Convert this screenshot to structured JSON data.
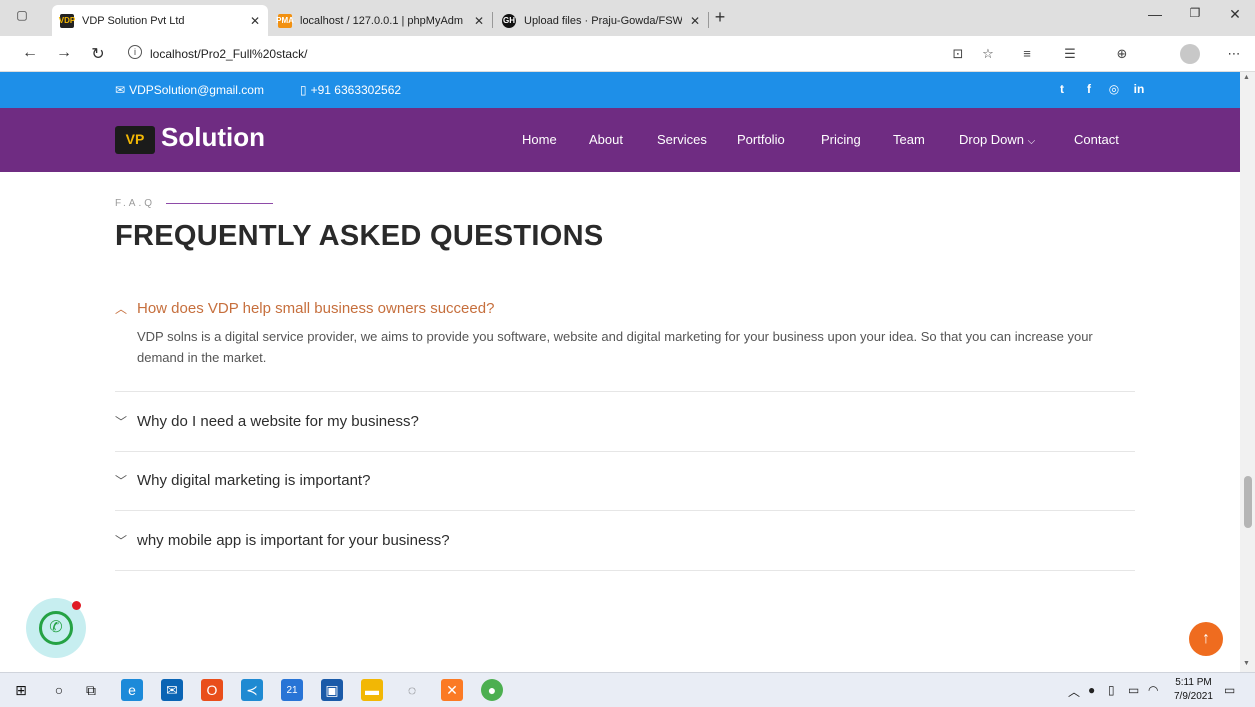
{
  "browser": {
    "tabs": [
      {
        "title": "VDP Solution Pvt Ltd",
        "favicon": "VDP",
        "active": true
      },
      {
        "title": "localhost / 127.0.0.1 | phpMyAdm",
        "favicon": "PMA",
        "active": false
      },
      {
        "title": "Upload files · Praju-Gowda/FSW_",
        "favicon": "GH",
        "active": false
      }
    ],
    "url": "localhost/Pro2_Full%20stack/"
  },
  "topbar": {
    "email": "VDPSolution@gmail.com",
    "phone": "+91 6363302562",
    "social": [
      "twitter-icon",
      "facebook-icon",
      "instagram-icon",
      "linkedin-icon"
    ]
  },
  "header": {
    "logo_mark": "VP",
    "logo_text": "Solution",
    "menu": [
      "Home",
      "About",
      "Services",
      "Portfolio",
      "Pricing",
      "Team",
      "Drop Down",
      "Contact"
    ]
  },
  "faq": {
    "eyebrow": "F.A.Q",
    "title": "FREQUENTLY ASKED QUESTIONS",
    "items": [
      {
        "question": "How does VDP help small business owners succeed?",
        "answer": "VDP solns is a digital service provider, we aims to provide you software, website and digital marketing for your business upon your idea. So that you can increase your demand in the market.",
        "open": true
      },
      {
        "question": "Why do I need a website for my business?",
        "open": false
      },
      {
        "question": "Why digital marketing is important?",
        "open": false
      },
      {
        "question": "why mobile app is important for your business?",
        "open": false
      }
    ]
  },
  "taskbar": {
    "clock_time": "5:11 PM",
    "clock_date": "7/9/2021",
    "store_badge": "21"
  },
  "colors": {
    "topbar": "#1e8fe8",
    "header": "#6f2c82",
    "faq_open": "#c66f3d",
    "back_to_top": "#ef6c1f",
    "whatsapp": "#25a244"
  }
}
